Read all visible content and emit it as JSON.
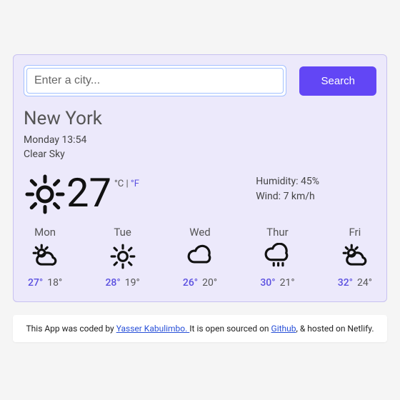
{
  "search": {
    "placeholder": "Enter a city...",
    "button": "Search"
  },
  "city": "New York",
  "datetime": "Monday 13:54",
  "condition": "Clear Sky",
  "current": {
    "temp": "27",
    "units_c": "°C",
    "sep": " | ",
    "units_f": "°F",
    "icon": "sun"
  },
  "details": {
    "humidity_label": "Humidity: ",
    "humidity_value": "45%",
    "wind_label": "Wind: ",
    "wind_value": "7 km/h"
  },
  "forecast": [
    {
      "day": "Mon",
      "icon": "partly",
      "hi": "27°",
      "lo": "18°"
    },
    {
      "day": "Tue",
      "icon": "sun",
      "hi": "28°",
      "lo": "19°"
    },
    {
      "day": "Wed",
      "icon": "cloud",
      "hi": "26°",
      "lo": "20°"
    },
    {
      "day": "Thur",
      "icon": "drizzle",
      "hi": "30°",
      "lo": "21°"
    },
    {
      "day": "Fri",
      "icon": "partly",
      "hi": "32°",
      "lo": "24°"
    }
  ],
  "footer": {
    "pre": "This App was coded by ",
    "author": "Yasser Kabulimbo. ",
    "mid": "It is open sourced on ",
    "github": "Github",
    "post": ", & hosted on Netlify."
  },
  "icons": {
    "sun": "sun-icon",
    "partly": "partly-cloudy-icon",
    "cloud": "cloud-icon",
    "drizzle": "drizzle-icon"
  }
}
